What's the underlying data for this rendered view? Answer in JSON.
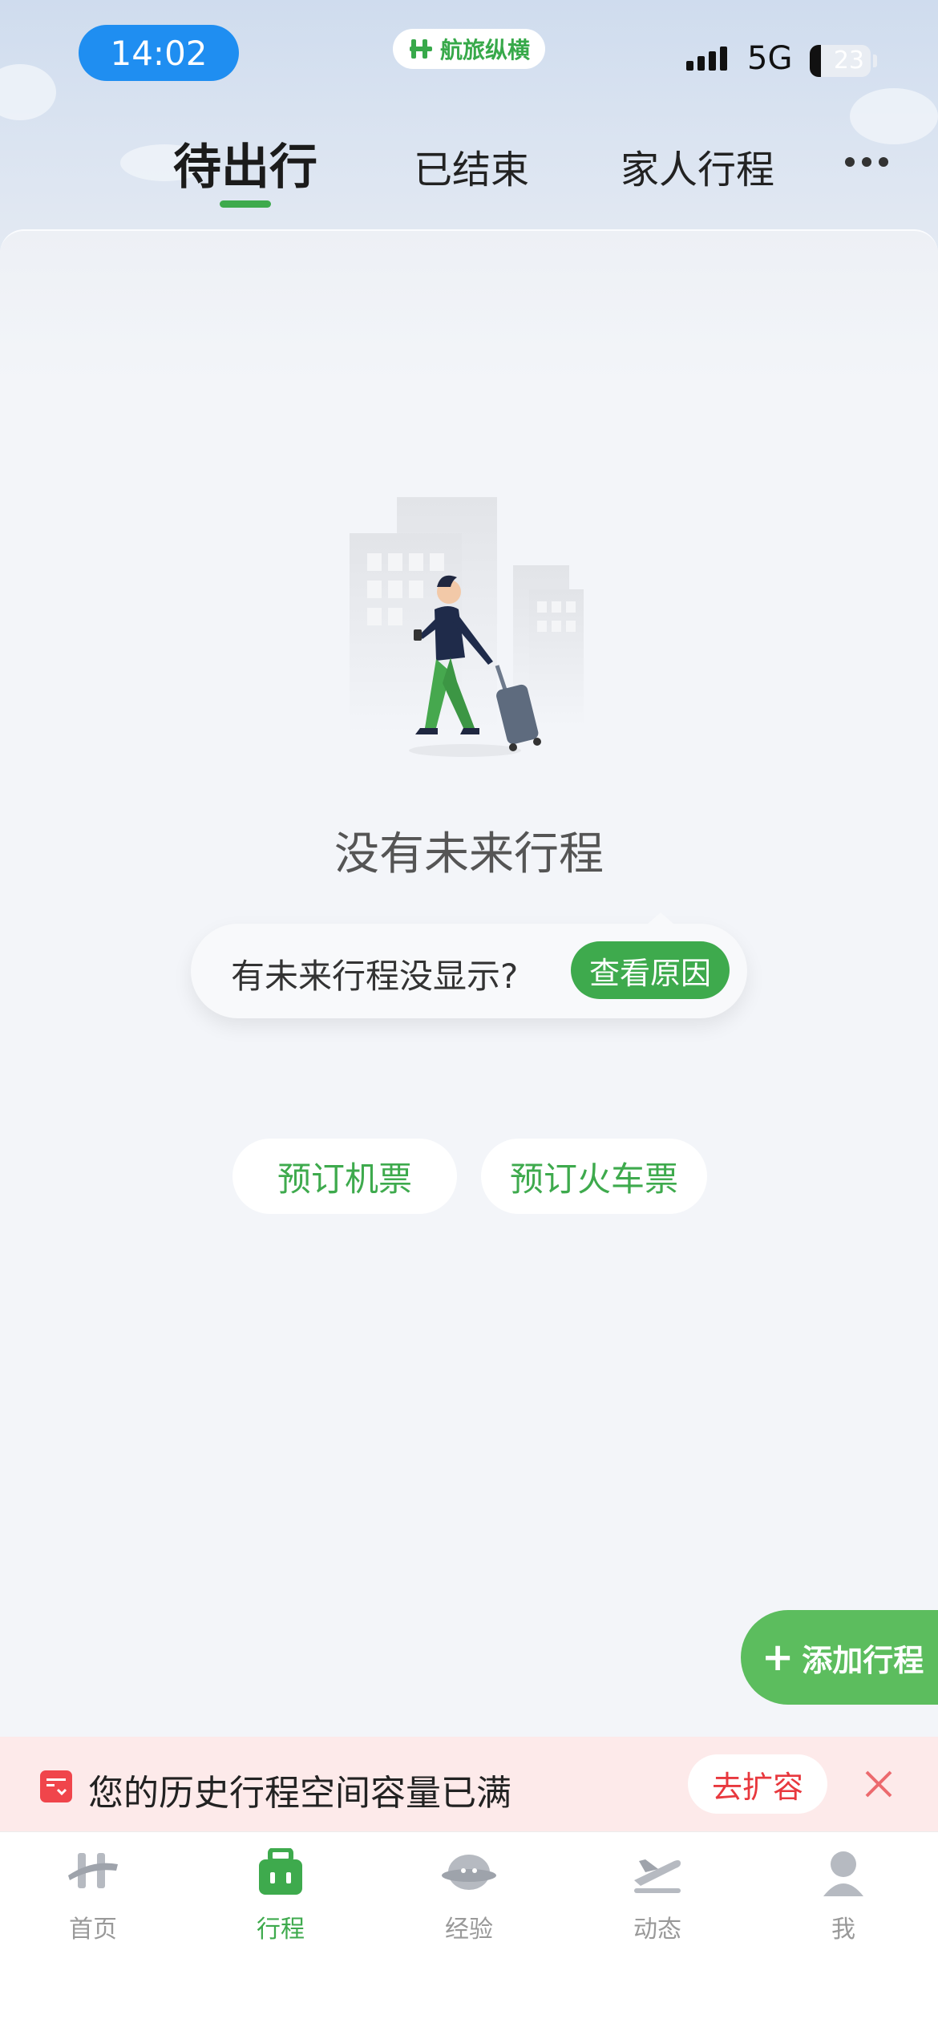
{
  "status_bar": {
    "time": "14:02",
    "app_name": "航旅纵横",
    "network": "5G",
    "battery": "23"
  },
  "tabs": [
    {
      "label": "待出行",
      "active": true
    },
    {
      "label": "已结束",
      "active": false
    },
    {
      "label": "家人行程",
      "active": false
    }
  ],
  "empty_state": {
    "title": "没有未来行程",
    "hint_text": "有未来行程没显示?",
    "hint_button": "查看原因"
  },
  "actions": {
    "book_flight": "预订机票",
    "book_train": "预订火车票",
    "add_trip": "添加行程"
  },
  "banner": {
    "text": "您的历史行程空间容量已满",
    "button": "去扩容"
  },
  "tabbar": [
    {
      "label": "首页",
      "icon": "home-icon"
    },
    {
      "label": "行程",
      "icon": "trip-icon",
      "active": true
    },
    {
      "label": "经验",
      "icon": "experience-icon"
    },
    {
      "label": "动态",
      "icon": "flight-status-icon"
    },
    {
      "label": "我",
      "icon": "profile-icon"
    }
  ],
  "colors": {
    "accent_green": "#3eaa4d",
    "time_pill_blue": "#1f8ef1",
    "alert_red": "#e8383e"
  }
}
